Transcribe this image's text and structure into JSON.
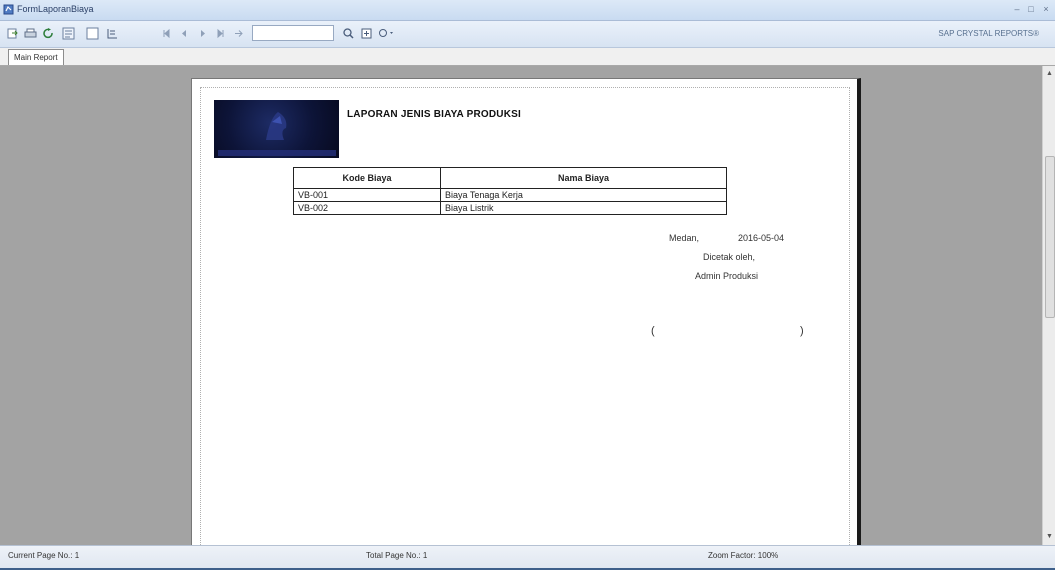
{
  "window": {
    "title": "FormLaporanBiaya",
    "controls": [
      "–",
      "□",
      "×"
    ]
  },
  "toolbar": {
    "brand": "SAP CRYSTAL REPORTS®",
    "icons": [
      "export-icon",
      "print-icon",
      "refresh-icon",
      "toggle-tree-icon",
      "group-tree-icon",
      "parameter-icon",
      "first-page-icon",
      "prev-page-icon",
      "next-page-icon",
      "last-page-icon",
      "goto-page-icon",
      "find-icon",
      "zoom-icon"
    ]
  },
  "tab": {
    "label": "Main Report"
  },
  "report": {
    "title": "LAPORAN JENIS BIAYA PRODUKSI",
    "table": {
      "headers": [
        "Kode Biaya",
        "Nama Biaya"
      ],
      "rows": [
        [
          "VB-001",
          "Biaya Tenaga Kerja"
        ],
        [
          "VB-002",
          "Biaya Listrik"
        ]
      ]
    },
    "city": "Medan,",
    "date": "2016-05-04",
    "printed_by": "Dicetak oleh,",
    "signer": "Admin Produksi",
    "paren_open": "(",
    "paren_close": ")"
  },
  "status": {
    "current_page": "Current Page No.: 1",
    "total_page": "Total Page No.: 1",
    "zoom": "Zoom Factor: 100%"
  }
}
